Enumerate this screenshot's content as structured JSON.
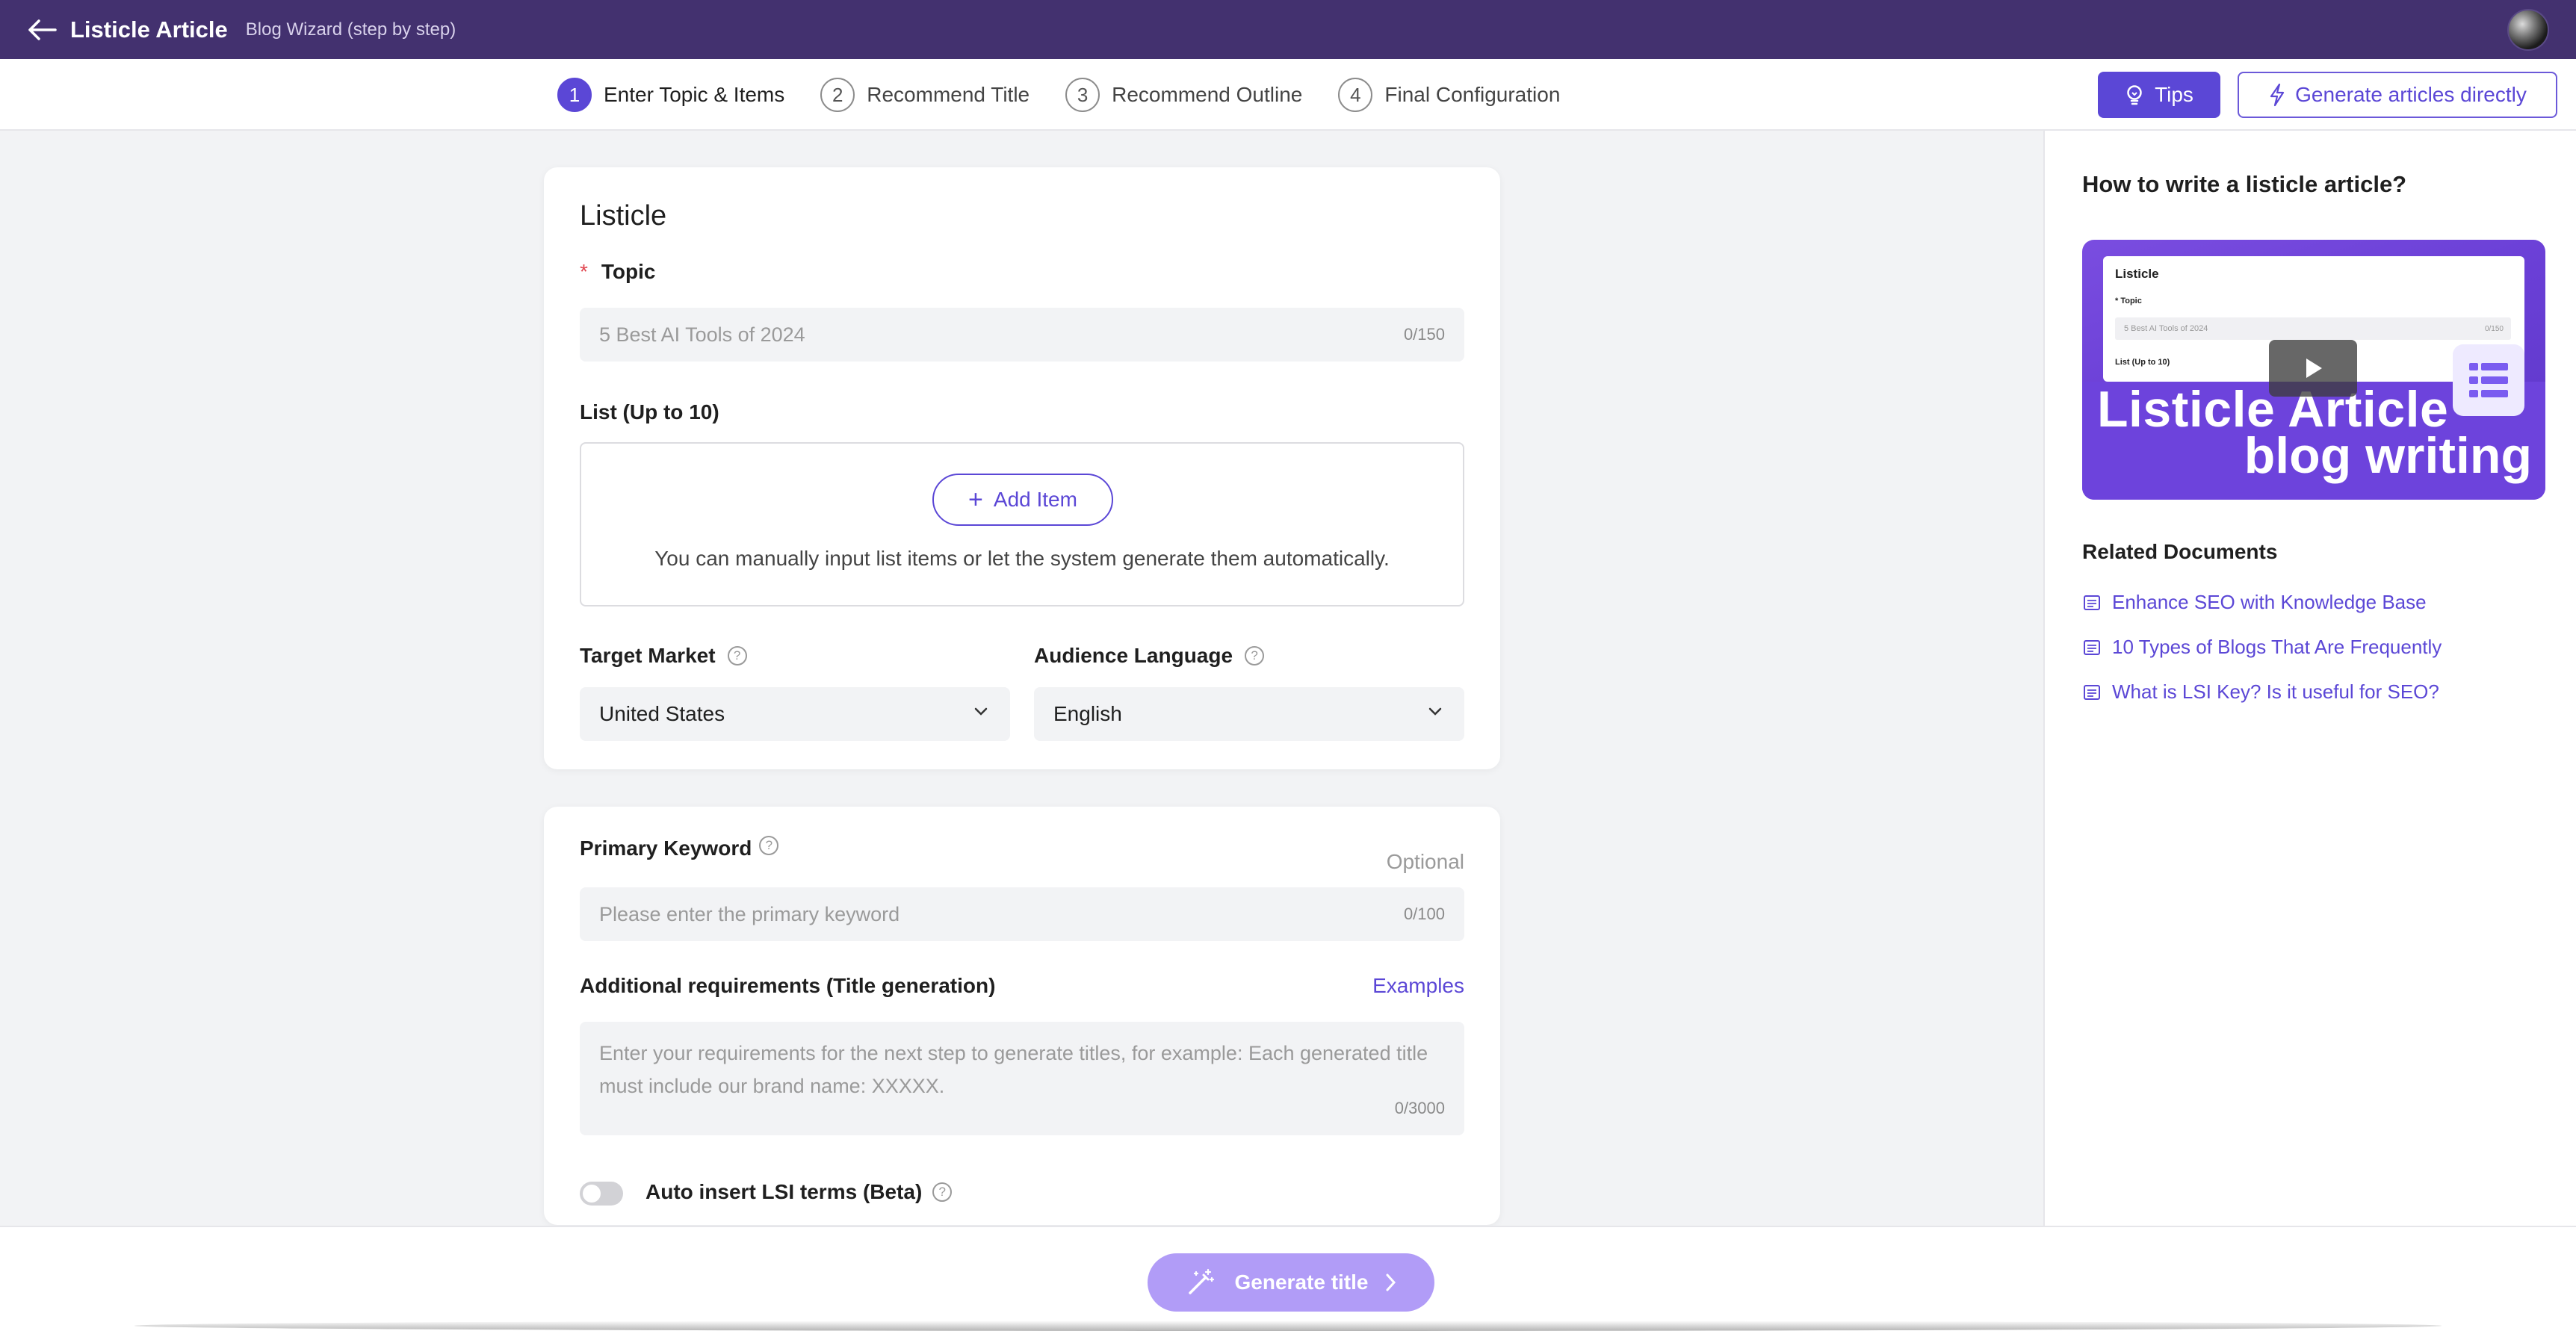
{
  "header": {
    "title": "Listicle Article",
    "subtitle": "Blog Wizard (step by step)"
  },
  "steps": [
    {
      "num": "1",
      "label": "Enter Topic & Items"
    },
    {
      "num": "2",
      "label": "Recommend Title"
    },
    {
      "num": "3",
      "label": "Recommend Outline"
    },
    {
      "num": "4",
      "label": "Final Configuration"
    }
  ],
  "toolbar": {
    "tips_label": "Tips",
    "generate_direct_label": "Generate articles directly"
  },
  "card1": {
    "title": "Listicle",
    "topic_label": "Topic",
    "topic_placeholder": "5 Best AI Tools of 2024",
    "topic_counter": "0/150",
    "list_label": "List (Up to 10)",
    "add_item_label": "Add Item",
    "list_hint": "You can manually input list items or let the system generate them automatically.",
    "target_market_label": "Target Market",
    "target_market_value": "United States",
    "audience_language_label": "Audience Language",
    "audience_language_value": "English"
  },
  "card2": {
    "primary_keyword_label": "Primary Keyword",
    "optional_label": "Optional",
    "primary_keyword_placeholder": "Please enter the primary keyword",
    "primary_keyword_counter": "0/100",
    "additional_label": "Additional requirements (Title generation)",
    "examples_label": "Examples",
    "additional_placeholder": "Enter your requirements for the next step to generate titles, for example: Each generated title must include our brand name: XXXXX.",
    "additional_counter": "0/3000",
    "lsi_label": "Auto insert LSI terms (Beta)",
    "lsi_enabled": false
  },
  "side": {
    "title": "How to write a listicle article?",
    "video": {
      "mock_title": "Listicle",
      "mock_topic": "Topic",
      "mock_input": "5 Best AI Tools of 2024",
      "mock_counter": "0/150",
      "mock_list": "List (Up to 10)",
      "line1": "Listicle Article",
      "line2": "blog writing"
    },
    "related_title": "Related Documents",
    "docs": [
      "Enhance SEO with Knowledge Base",
      "10 Types of Blogs That Are Frequently",
      "What is LSI Key? Is it useful for SEO?"
    ]
  },
  "footer": {
    "generate_title_label": "Generate title"
  },
  "colors": {
    "header_bg": "#43316f",
    "accent": "#5b47d6",
    "generate_button": "#b19cf7"
  }
}
